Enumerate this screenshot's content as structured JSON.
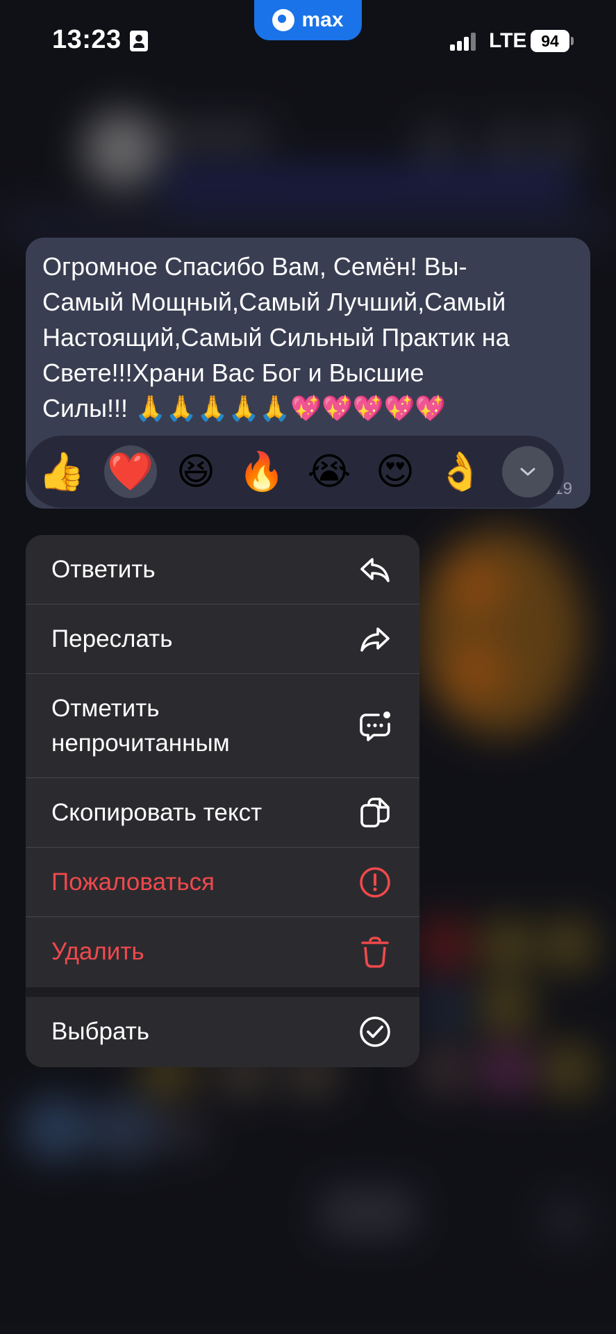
{
  "status_bar": {
    "time": "13:23",
    "app_name": "max",
    "network": "LTE",
    "battery": "94"
  },
  "message": {
    "text": "Огромное Спасибо Вам, Семён! Вы-\nСамый Мощный,Самый Лучший,Самый\nНастоящий,Самый Сильный Практик на\nСвете!!!Храни Вас Бог и  Высшие\nСилы!!! 🙏🙏🙏🙏🙏💖💖💖💖💖",
    "time_fragment": "19"
  },
  "reactions": {
    "items": [
      {
        "emoji": "👍",
        "name": "thumbs-up"
      },
      {
        "emoji": "❤️",
        "name": "red-heart",
        "selected": true
      },
      {
        "emoji": "😆",
        "name": "laughing"
      },
      {
        "emoji": "🔥",
        "name": "fire"
      },
      {
        "emoji": "😭",
        "name": "crying"
      },
      {
        "emoji": "😍",
        "name": "heart-eyes"
      },
      {
        "emoji": "👌",
        "name": "ok-hand"
      }
    ],
    "more_icon": "chevron-down-icon"
  },
  "menu": {
    "reply": {
      "label": "Ответить",
      "icon": "reply-icon"
    },
    "forward": {
      "label": "Переслать",
      "icon": "forward-icon"
    },
    "mark_unread": {
      "label": "Отметить\nнепрочитанным",
      "icon": "unread-message-icon"
    },
    "copy_text": {
      "label": "Скопировать текст",
      "icon": "copy-icon"
    },
    "report": {
      "label": "Пожаловаться",
      "icon": "exclamation-circle-icon"
    },
    "delete": {
      "label": "Удалить",
      "icon": "trash-icon"
    },
    "select": {
      "label": "Выбрать",
      "icon": "check-circle-icon"
    }
  },
  "colors": {
    "bubble": "#3a3e52",
    "menu_background": "#2b2b2f",
    "danger": "#f0494c",
    "accent": "#1a73e8"
  }
}
